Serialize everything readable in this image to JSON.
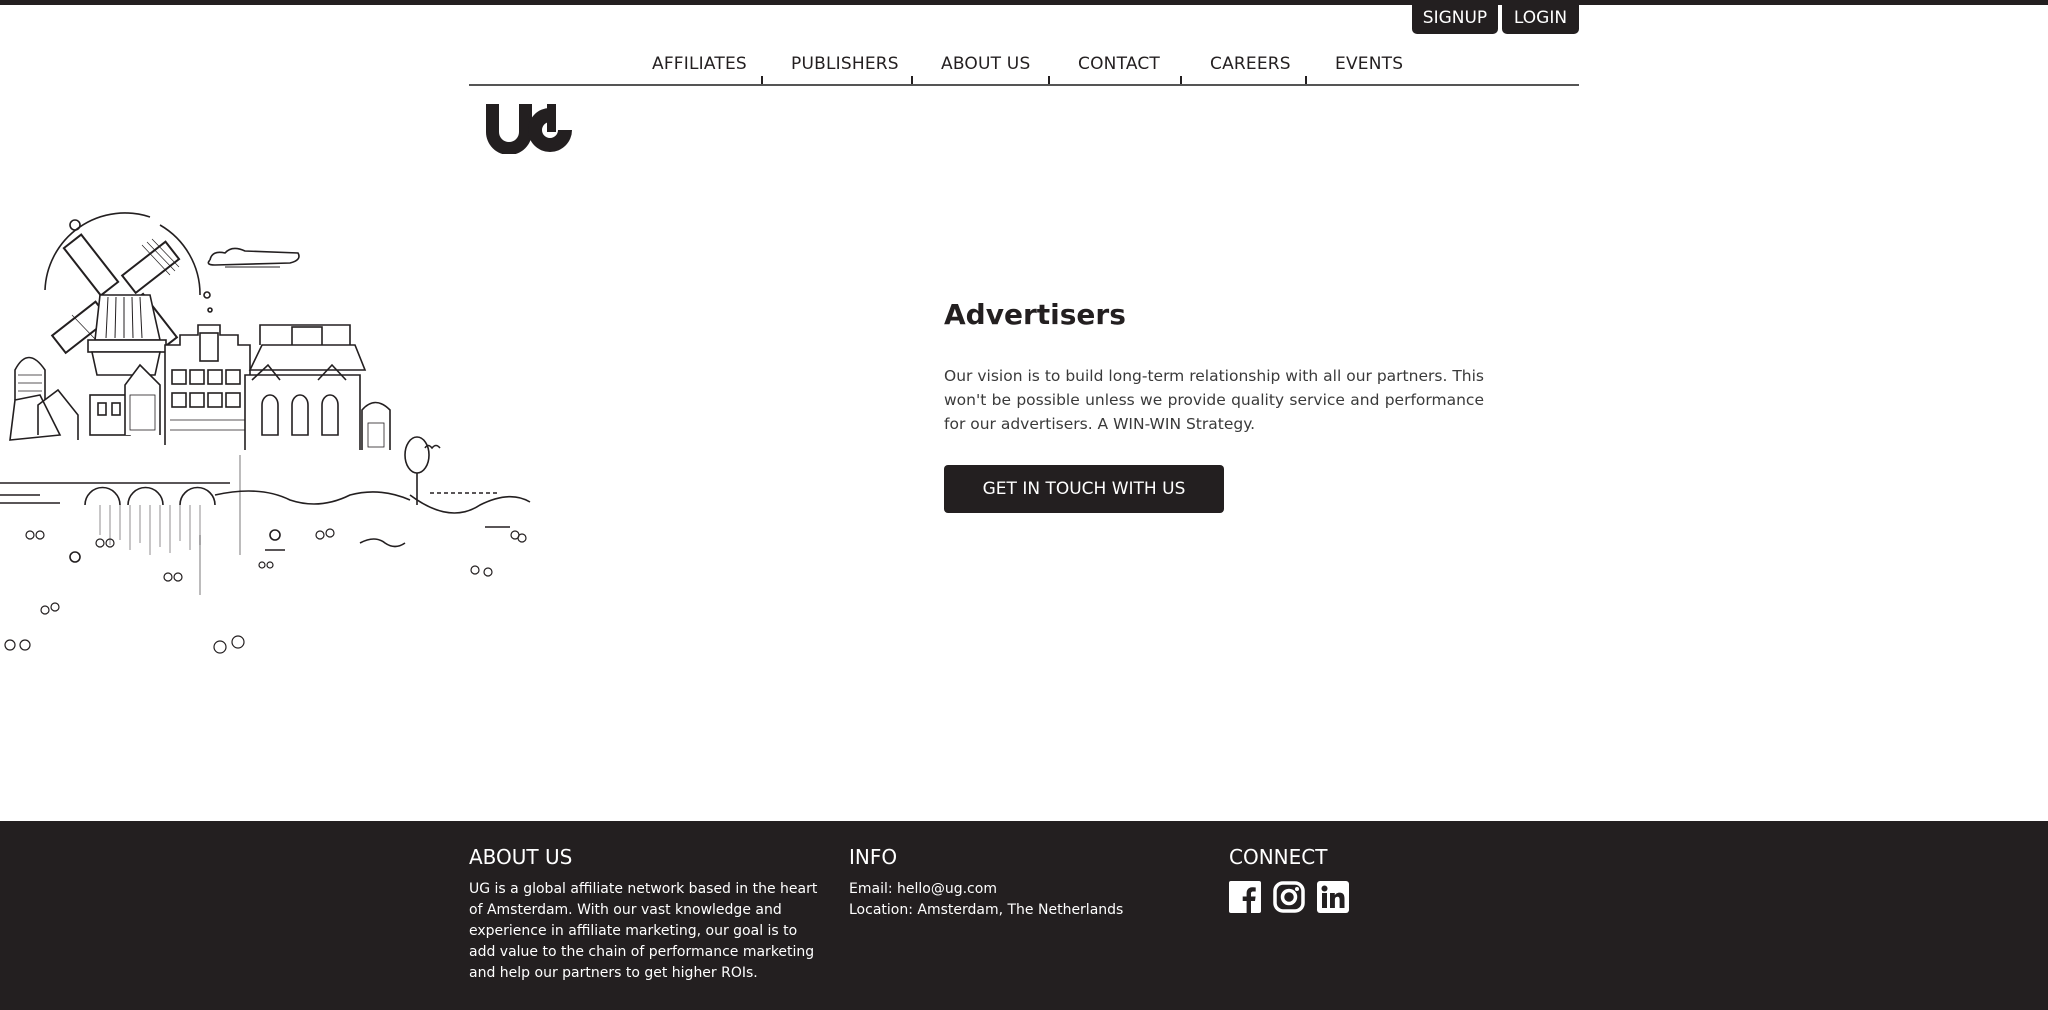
{
  "header": {
    "signup_label": "SIGNUP",
    "login_label": "LOGIN"
  },
  "nav": {
    "items": [
      "AFFILIATES",
      "PUBLISHERS",
      "ABOUT US",
      "CONTACT",
      "CAREERS",
      "EVENTS"
    ]
  },
  "brand": {
    "logo_text": "UG"
  },
  "hero": {
    "title": "Advertisers",
    "text": "Our vision is to build long-term relationship with all our partners. This won't be possible unless we provide quality service and performance for our advertisers. A WIN-WIN Strategy.",
    "cta_label": "GET IN TOUCH WITH US",
    "illustration_icon": "amsterdam-skyline-illustration"
  },
  "footer": {
    "about": {
      "title": "ABOUT US",
      "text": "UG is a global affiliate network based in the heart of Amsterdam. With our vast knowledge and experience in affiliate marketing, our goal is to add value to the chain of performance marketing and help our partners to get higher ROIs."
    },
    "info": {
      "title": "INFO",
      "email": "Email: hello@ug.com",
      "location": "Location: Amsterdam, The Netherlands"
    },
    "connect": {
      "title": "CONNECT",
      "icons": [
        "facebook-icon",
        "instagram-icon",
        "linkedin-icon"
      ]
    }
  },
  "colors": {
    "dark": "#231f20",
    "background": "#ffffff"
  }
}
